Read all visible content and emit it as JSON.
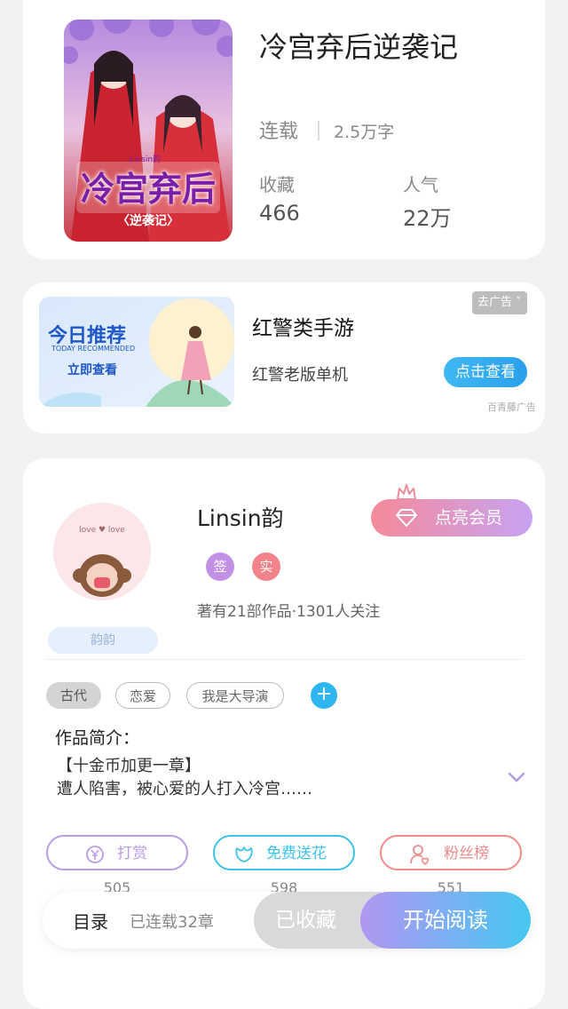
{
  "book": {
    "title": "冷宫弃后逆袭记",
    "status": "连载",
    "word_count": "2.5万字",
    "stats": [
      {
        "label": "收藏",
        "value": "466"
      },
      {
        "label": "人气",
        "value": "22万"
      }
    ],
    "cover": {
      "title_art": "冷宫弃后",
      "subtitle_art": "〈逆袭记〉",
      "author_mark": "Linsin韵"
    }
  },
  "ad": {
    "image_title": "今日推荐",
    "image_subtitle": "TODAY RECOMMENDED",
    "image_button": "立即查看",
    "title": "红警类手游",
    "subtitle": "红警老版单机",
    "button": "点击查看",
    "close_label": "去广告 ˅",
    "source": "百青藤广告"
  },
  "author": {
    "name": "Linsin韵",
    "badges": [
      {
        "label": "签",
        "color": "#c291e6"
      },
      {
        "label": "实",
        "color": "#f2838a"
      }
    ],
    "meta": "著有21部作品·1301人关注",
    "vip_button": "点亮会员",
    "nickname_plate": "韵韵",
    "avatar_text": "love ♥ love"
  },
  "tags": [
    {
      "label": "古代",
      "active": true
    },
    {
      "label": "恋爱",
      "active": false
    },
    {
      "label": "我是大导演",
      "active": false
    }
  ],
  "intro": {
    "title": "作品简介：",
    "line1": "【十金币加更一章】",
    "line2": "遭人陷害，被心爱的人打入冷宫……"
  },
  "actions": [
    {
      "label": "打赏",
      "count": "505",
      "color": "#b99be6",
      "icon": "yen-circle-icon"
    },
    {
      "label": "免费送花",
      "count": "598",
      "color": "#3cc3ec",
      "icon": "flower-icon"
    },
    {
      "label": "粉丝榜",
      "count": "551",
      "color": "#f08a8a",
      "icon": "fan-user-icon"
    }
  ],
  "bottom_bar": {
    "toc": "目录",
    "chapter_count": "已连载32章",
    "collected": "已收藏",
    "read": "开始阅读"
  }
}
